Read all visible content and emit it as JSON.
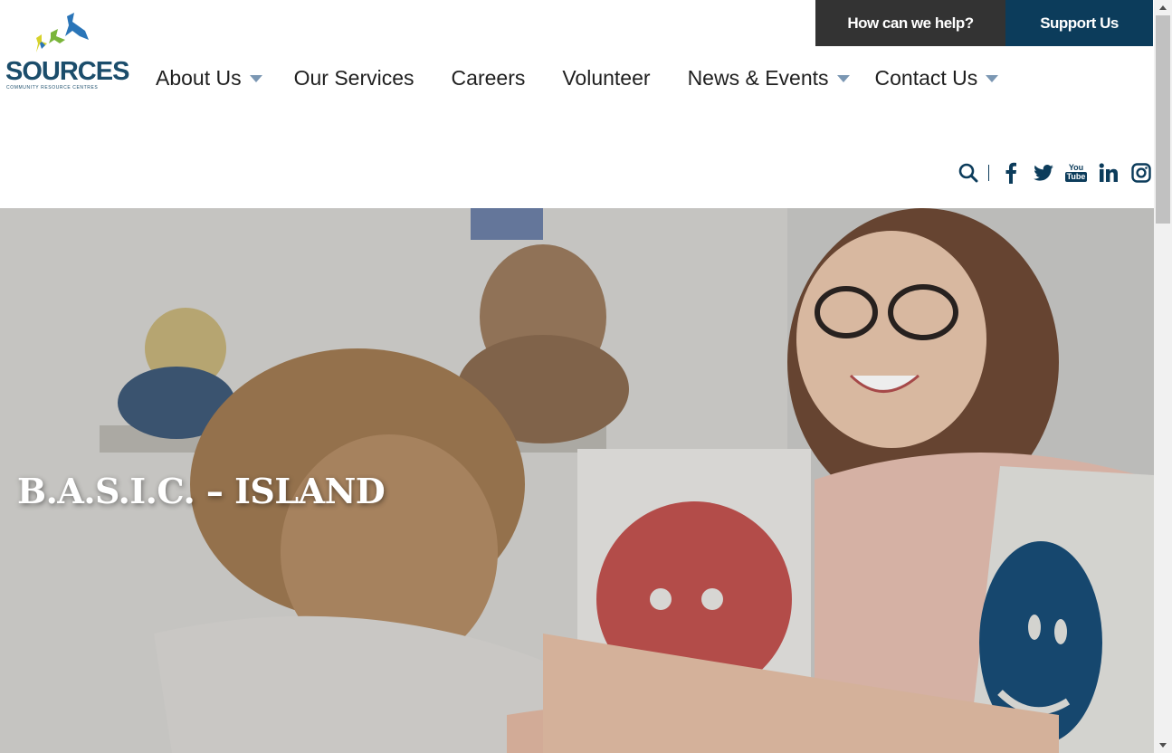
{
  "logo": {
    "name": "SOURCES",
    "tagline": "COMMUNITY RESOURCE CENTRES",
    "colors": {
      "text": "#1b4d6b",
      "bird_blue": "#2a75b8",
      "bird_green": "#7ab53a",
      "bird_yellow": "#d7d22a"
    }
  },
  "top_buttons": {
    "help": "How can we help?",
    "support": "Support Us"
  },
  "nav": {
    "items": [
      {
        "label": "About Us",
        "has_dropdown": true
      },
      {
        "label": "Our Services",
        "has_dropdown": false
      },
      {
        "label": "Careers",
        "has_dropdown": false
      },
      {
        "label": "Volunteer",
        "has_dropdown": false
      },
      {
        "label": "News & Events",
        "has_dropdown": true
      },
      {
        "label": "Contact Us",
        "has_dropdown": true
      }
    ]
  },
  "social": {
    "icons": [
      "search-icon",
      "facebook-icon",
      "twitter-icon",
      "youtube-icon",
      "linkedin-icon",
      "instagram-icon"
    ],
    "youtube_text_top": "You",
    "youtube_text_bottom": "Tube"
  },
  "hero": {
    "title": "B.A.S.I.C. – ISLAND"
  },
  "colors": {
    "primary": "#0c3c5b",
    "help_button": "#333333",
    "nav_caret": "#7b97b3",
    "face_red": "#c1524f",
    "face_blue": "#184d77"
  }
}
